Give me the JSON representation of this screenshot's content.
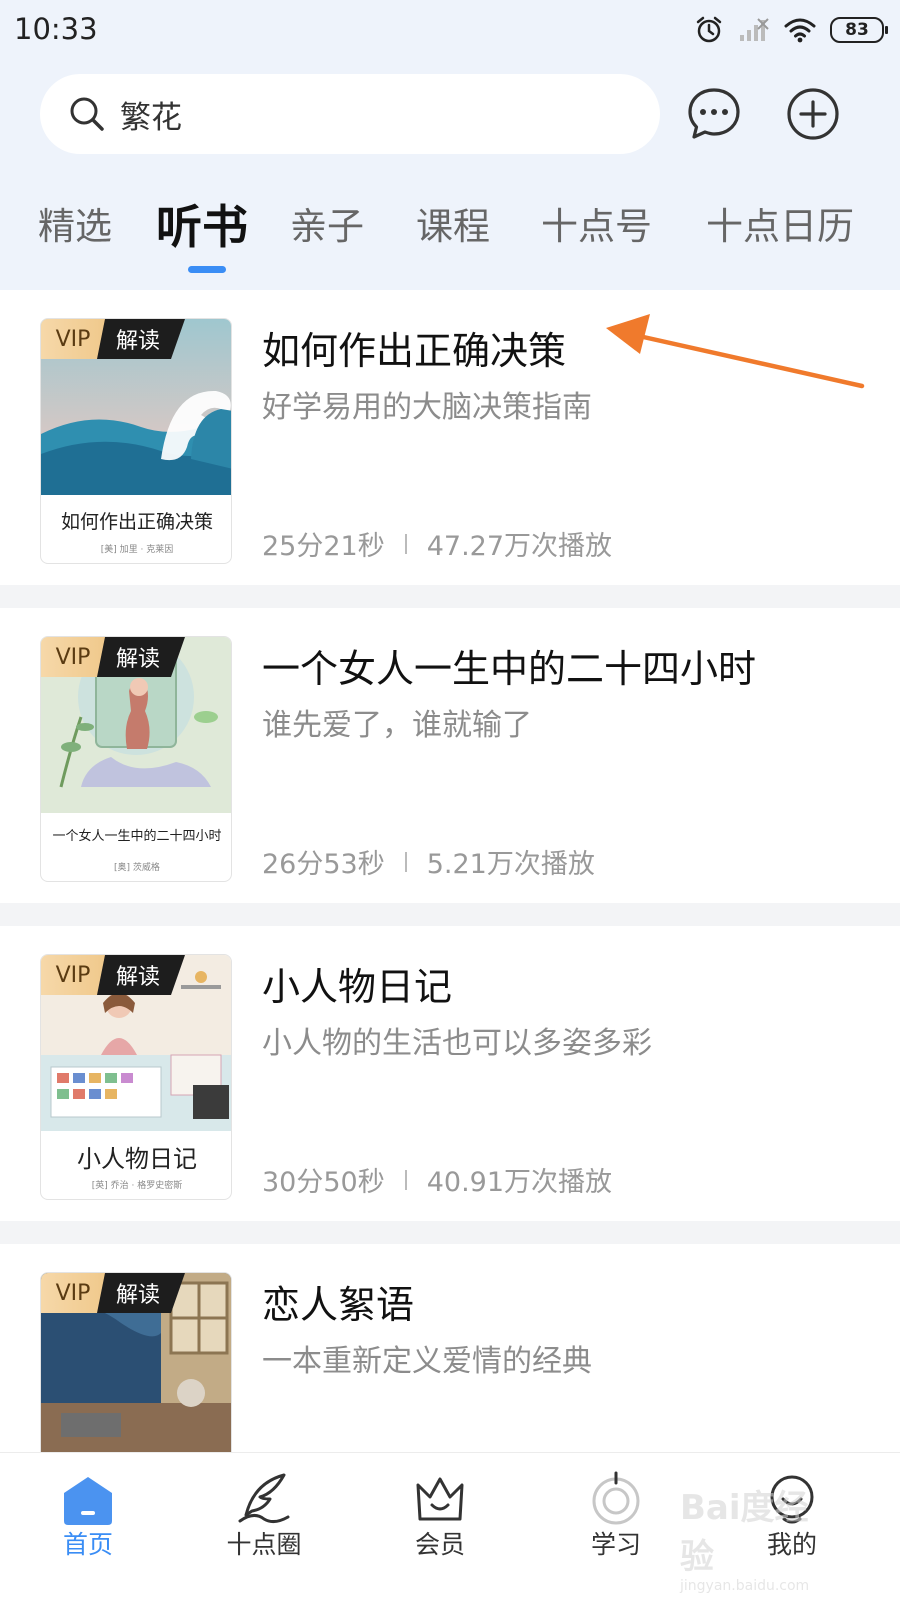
{
  "status_bar": {
    "time": "10:33",
    "battery": "83"
  },
  "search": {
    "text": "繁花"
  },
  "tabs": [
    {
      "label": "精选"
    },
    {
      "label": "听书"
    },
    {
      "label": "亲子"
    },
    {
      "label": "课程"
    },
    {
      "label": "十点号"
    },
    {
      "label": "十点日历"
    }
  ],
  "active_tab": "听书",
  "badge": {
    "vip": "VIP",
    "type": "解读"
  },
  "books": [
    {
      "title": "如何作出正确决策",
      "subtitle": "好学易用的大脑决策指南",
      "duration": "25分21秒",
      "plays": "47.27万次播放",
      "cover_title": "如何作出正确决策",
      "cover_author": "[美] 加里 · 克莱因"
    },
    {
      "title": "一个女人一生中的二十四小时",
      "subtitle": "谁先爱了，谁就输了",
      "duration": "26分53秒",
      "plays": "5.21万次播放",
      "cover_title": "一个女人一生中的二十四小时",
      "cover_author": "[奥] 茨威格"
    },
    {
      "title": "小人物日记",
      "subtitle": "小人物的生活也可以多姿多彩",
      "duration": "30分50秒",
      "plays": "40.91万次播放",
      "cover_title": "小人物日记",
      "cover_author": "[英] 乔治 · 格罗史密斯"
    },
    {
      "title": "恋人絮语",
      "subtitle": "一本重新定义爱情的经典",
      "duration": "",
      "plays": "",
      "cover_title": "",
      "cover_author": ""
    }
  ],
  "bottom_nav": [
    {
      "label": "首页",
      "icon": "home-icon"
    },
    {
      "label": "十点圈",
      "icon": "quill-icon"
    },
    {
      "label": "会员",
      "icon": "crown-icon"
    },
    {
      "label": "学习",
      "icon": "study-icon"
    },
    {
      "label": "我的",
      "icon": "profile-icon"
    }
  ],
  "watermark": {
    "text": "Bai度经验",
    "sub": "jingyan.baidu.com"
  },
  "colors": {
    "accent": "#3a8df5",
    "arrow": "#f07a2c",
    "header_bg": "#eef3fb"
  }
}
